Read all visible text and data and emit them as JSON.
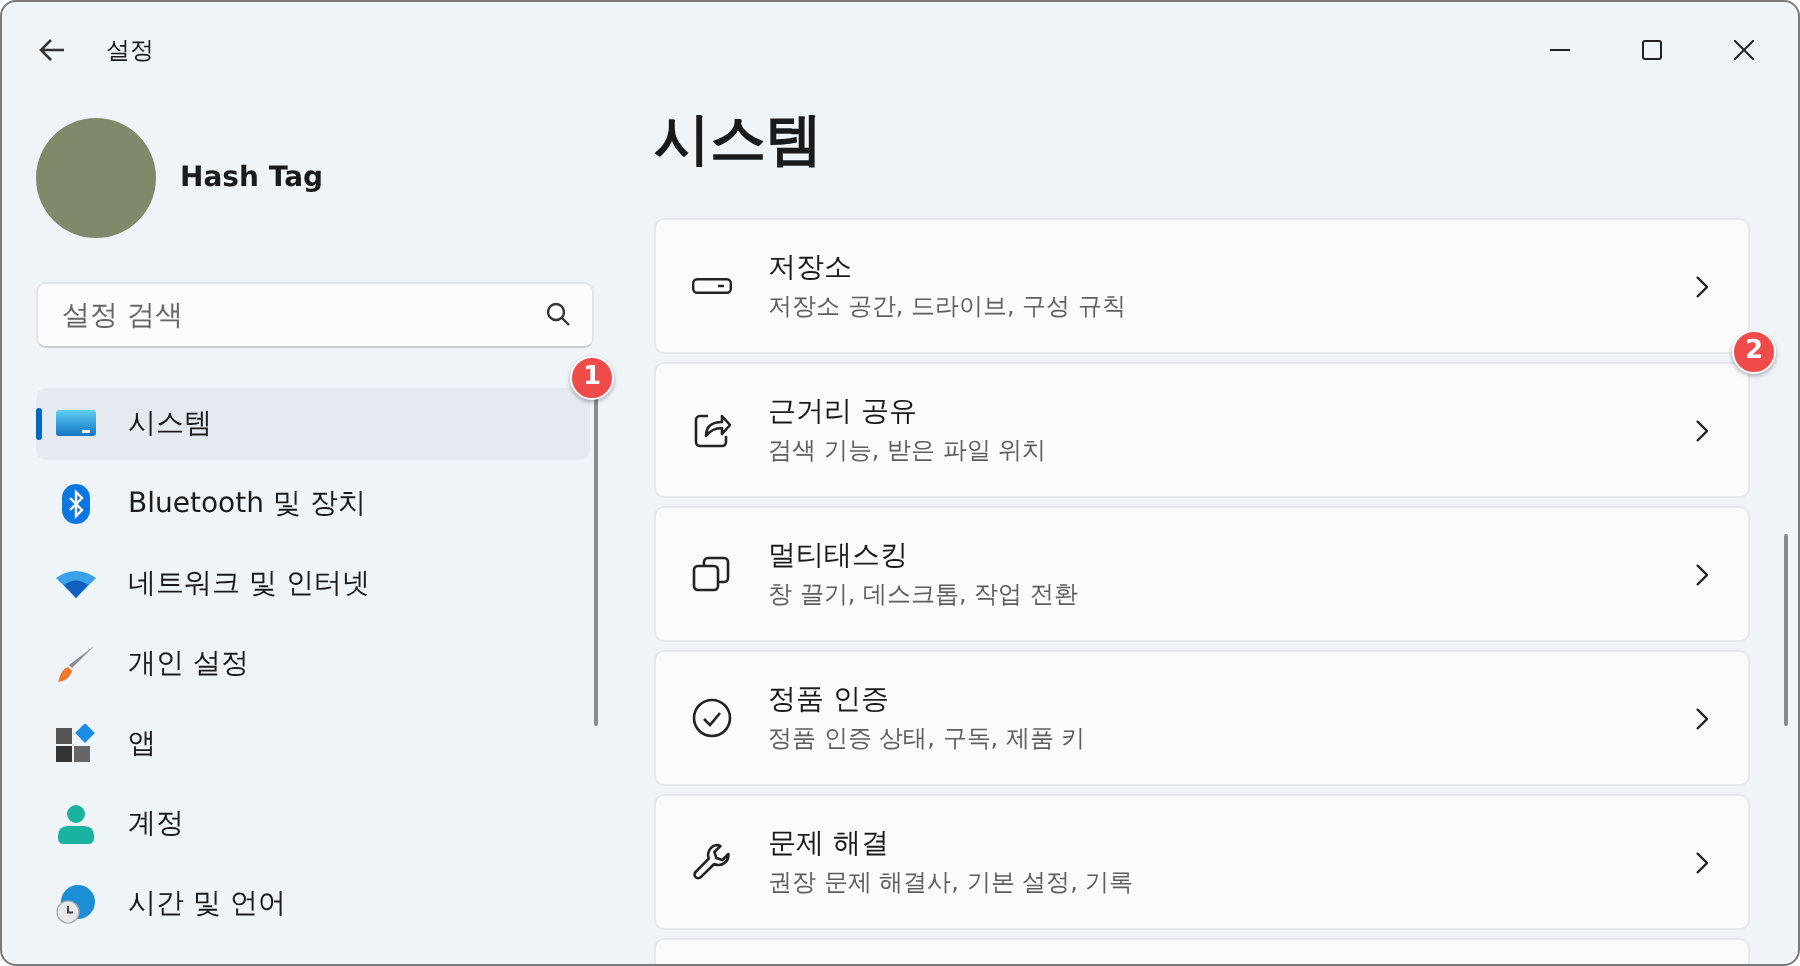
{
  "window": {
    "title": "설정"
  },
  "profile": {
    "name": "Hash Tag"
  },
  "search": {
    "placeholder": "설정 검색"
  },
  "nav": [
    {
      "label": "시스템",
      "selected": true,
      "callout": "1"
    },
    {
      "label": "Bluetooth 및 장치",
      "selected": false
    },
    {
      "label": "네트워크 및 인터넷",
      "selected": false
    },
    {
      "label": "개인 설정",
      "selected": false
    },
    {
      "label": "앱",
      "selected": false
    },
    {
      "label": "계정",
      "selected": false
    },
    {
      "label": "시간 및 언어",
      "selected": false
    }
  ],
  "page": {
    "title": "시스템"
  },
  "cards": [
    {
      "title": "저장소",
      "subtitle": "저장소 공간, 드라이브, 구성 규칙"
    },
    {
      "title": "근거리 공유",
      "subtitle": "검색 기능, 받은 파일 위치",
      "callout": "2"
    },
    {
      "title": "멀티태스킹",
      "subtitle": "창 끌기, 데스크톱, 작업 전환"
    },
    {
      "title": "정품 인증",
      "subtitle": "정품 인증 상태, 구독, 제품 키"
    },
    {
      "title": "문제 해결",
      "subtitle": "권장 문제 해결사, 기본 설정, 기록"
    }
  ]
}
